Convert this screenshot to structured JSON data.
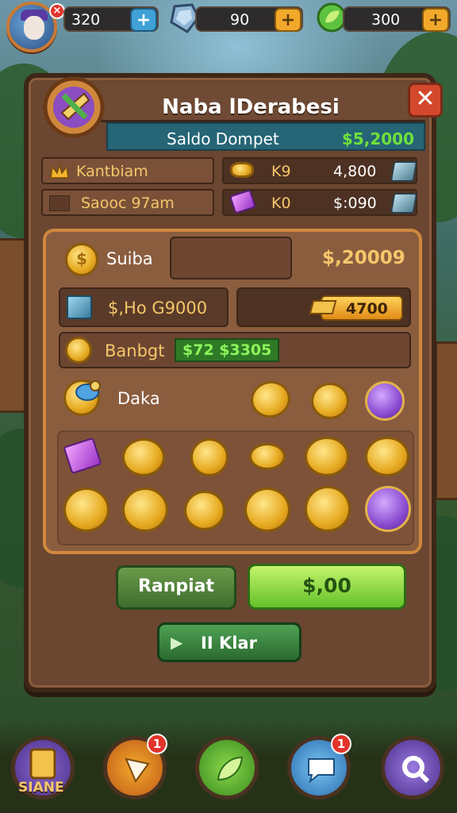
{
  "topbar": {
    "avatar_badge": "×",
    "resources": [
      {
        "value": "320",
        "plus": "+",
        "icon": "gear-icon",
        "color": "#3fa1d6"
      },
      {
        "value": "90",
        "plus": "+",
        "icon": "gem-icon",
        "color": "#f2a92b"
      },
      {
        "value": "300",
        "plus": "+",
        "icon": "leaf-icon",
        "color": "#f2a92b"
      }
    ]
  },
  "panel": {
    "title": "Naba lDerabesi",
    "close_label": "✕",
    "wallet_label": "Saldo Dompet",
    "wallet_value": "$5,2000",
    "info_rows": [
      {
        "label": "Kantbiam",
        "sub_label": "K9",
        "value": "4,800"
      },
      {
        "label": "Saooc 97am",
        "sub_label": "K0",
        "value": "$:090"
      }
    ],
    "suiba_label": "Suiba",
    "suiba_value": "$,20009",
    "ho_label": "$,Ho G9000",
    "gold_value": "4700",
    "banbgt_label": "Banbgt",
    "banbgt_value": "$72 $3305",
    "daka_label": "Daka",
    "coin_glyph": "$",
    "buttons": {
      "ranpiat": "Ranpiat",
      "buy": "$,00",
      "play": "II Klar",
      "play_icon": "▶"
    }
  },
  "bottom_nav": {
    "items": [
      {
        "label": "SIANE",
        "icon": "scroll-icon",
        "badge": ""
      },
      {
        "label": "",
        "icon": "crystal-icon",
        "badge": "1"
      },
      {
        "label": "",
        "icon": "leaf-icon",
        "badge": ""
      },
      {
        "label": "",
        "icon": "chat-icon",
        "badge": "1"
      },
      {
        "label": "",
        "icon": "search-icon",
        "badge": ""
      }
    ]
  },
  "colors": {
    "panel_brown": "#6b4630",
    "wallet_teal": "#256576",
    "money_green": "#6fe03b",
    "gold": "#f5c76a",
    "close_red": "#d3482c"
  }
}
